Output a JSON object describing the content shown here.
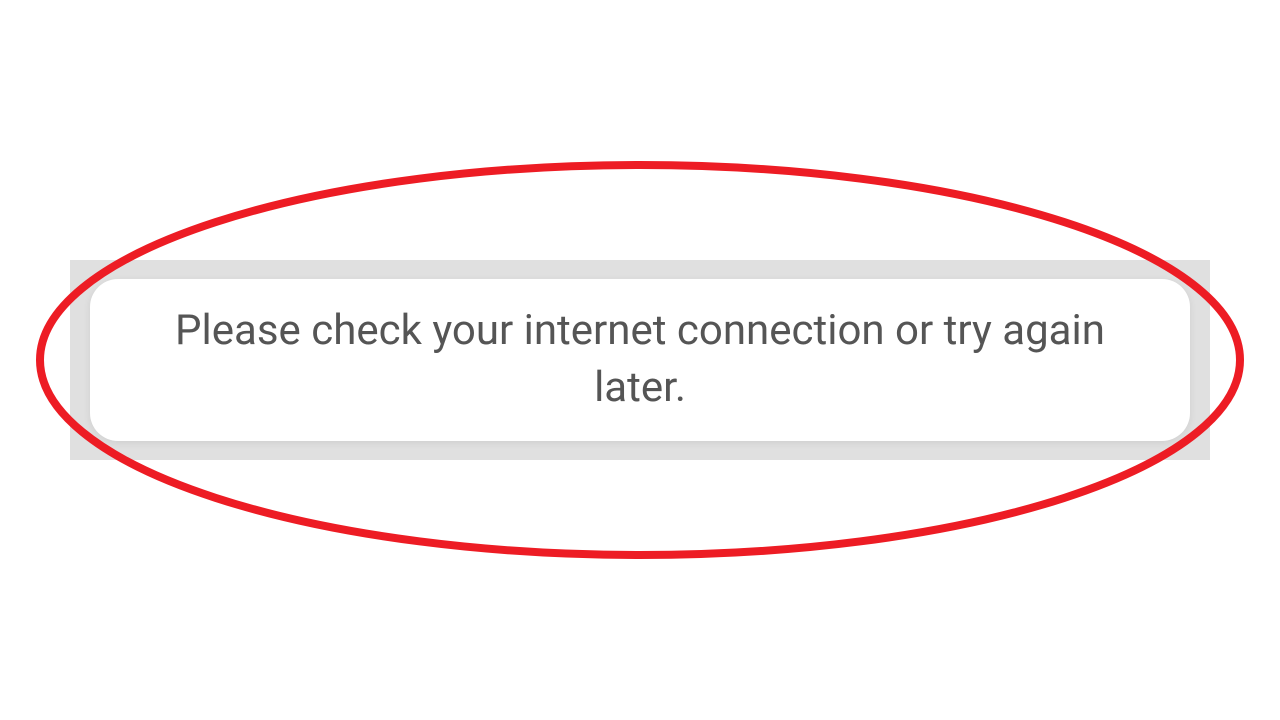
{
  "toast": {
    "message": "Please check your internet connection or try again later."
  },
  "annotation": {
    "stroke_color": "#ed1c24",
    "stroke_width": "8"
  }
}
